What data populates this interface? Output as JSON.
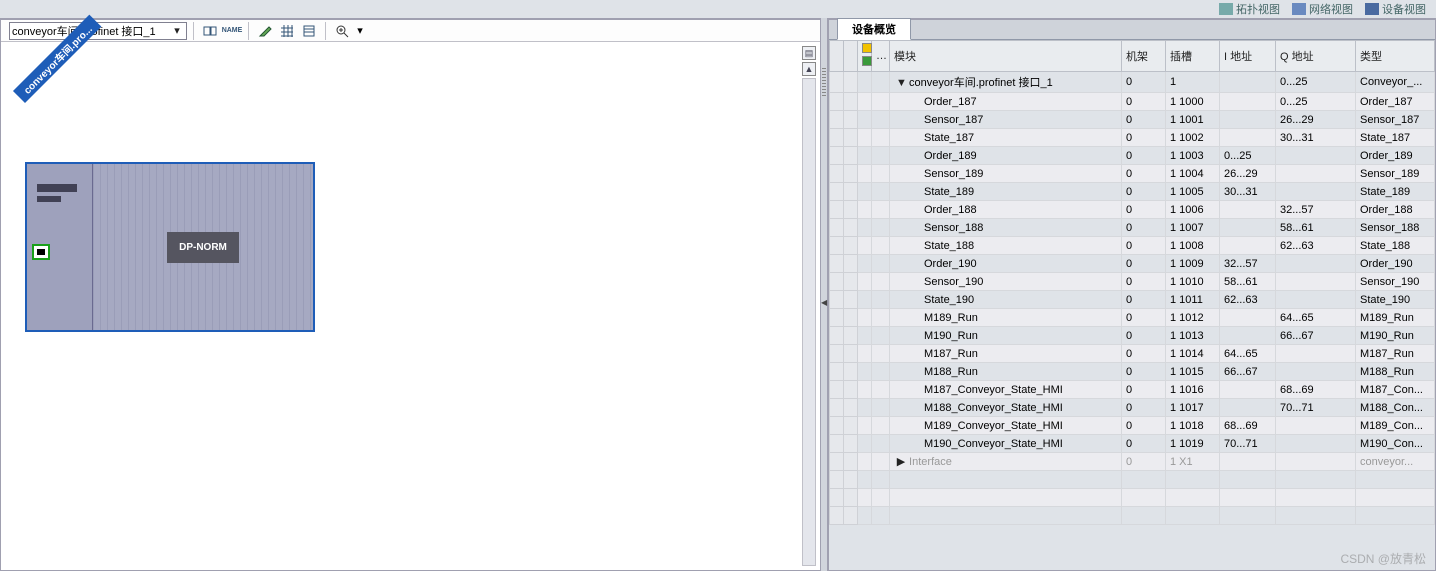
{
  "topTabs": {
    "t1": "拓扑视图",
    "t2": "网络视图",
    "t3": "设备视图"
  },
  "toolbar": {
    "selector": "conveyor车间.profinet 接口_1"
  },
  "editor": {
    "badge": "conveyor车间.pro...",
    "dpnorm": "DP-NORM"
  },
  "panel": {
    "title": "设备概览"
  },
  "columns": {
    "module": "模块",
    "rack": "机架",
    "slot": "插槽",
    "iaddr": "I 地址",
    "qaddr": "Q 地址",
    "type": "类型"
  },
  "rows": [
    {
      "indent": 1,
      "exp": "▼",
      "module": "conveyor车间.profinet 接口_1",
      "rack": "0",
      "slot": "1",
      "iaddr": "",
      "qaddr": "0...25",
      "type": "Conveyor_..."
    },
    {
      "indent": 2,
      "module": "Order_187",
      "rack": "0",
      "slot": "1 1000",
      "iaddr": "",
      "qaddr": "0...25",
      "type": "Order_187"
    },
    {
      "indent": 2,
      "module": "Sensor_187",
      "rack": "0",
      "slot": "1 1001",
      "iaddr": "",
      "qaddr": "26...29",
      "type": "Sensor_187"
    },
    {
      "indent": 2,
      "module": "State_187",
      "rack": "0",
      "slot": "1 1002",
      "iaddr": "",
      "qaddr": "30...31",
      "type": "State_187"
    },
    {
      "indent": 2,
      "module": "Order_189",
      "rack": "0",
      "slot": "1 1003",
      "iaddr": "0...25",
      "qaddr": "",
      "type": "Order_189"
    },
    {
      "indent": 2,
      "module": "Sensor_189",
      "rack": "0",
      "slot": "1 1004",
      "iaddr": "26...29",
      "qaddr": "",
      "type": "Sensor_189"
    },
    {
      "indent": 2,
      "module": "State_189",
      "rack": "0",
      "slot": "1 1005",
      "iaddr": "30...31",
      "qaddr": "",
      "type": "State_189"
    },
    {
      "indent": 2,
      "module": "Order_188",
      "rack": "0",
      "slot": "1 1006",
      "iaddr": "",
      "qaddr": "32...57",
      "type": "Order_188"
    },
    {
      "indent": 2,
      "module": "Sensor_188",
      "rack": "0",
      "slot": "1 1007",
      "iaddr": "",
      "qaddr": "58...61",
      "type": "Sensor_188"
    },
    {
      "indent": 2,
      "module": "State_188",
      "rack": "0",
      "slot": "1 1008",
      "iaddr": "",
      "qaddr": "62...63",
      "type": "State_188"
    },
    {
      "indent": 2,
      "module": "Order_190",
      "rack": "0",
      "slot": "1 1009",
      "iaddr": "32...57",
      "qaddr": "",
      "type": "Order_190"
    },
    {
      "indent": 2,
      "module": "Sensor_190",
      "rack": "0",
      "slot": "1 1010",
      "iaddr": "58...61",
      "qaddr": "",
      "type": "Sensor_190"
    },
    {
      "indent": 2,
      "module": "State_190",
      "rack": "0",
      "slot": "1 1011",
      "iaddr": "62...63",
      "qaddr": "",
      "type": "State_190"
    },
    {
      "indent": 2,
      "module": "M189_Run",
      "rack": "0",
      "slot": "1 1012",
      "iaddr": "",
      "qaddr": "64...65",
      "type": "M189_Run"
    },
    {
      "indent": 2,
      "module": "M190_Run",
      "rack": "0",
      "slot": "1 1013",
      "iaddr": "",
      "qaddr": "66...67",
      "type": "M190_Run"
    },
    {
      "indent": 2,
      "module": "M187_Run",
      "rack": "0",
      "slot": "1 1014",
      "iaddr": "64...65",
      "qaddr": "",
      "type": "M187_Run"
    },
    {
      "indent": 2,
      "module": "M188_Run",
      "rack": "0",
      "slot": "1 1015",
      "iaddr": "66...67",
      "qaddr": "",
      "type": "M188_Run"
    },
    {
      "indent": 2,
      "module": "M187_Conveyor_State_HMI",
      "rack": "0",
      "slot": "1 1016",
      "iaddr": "",
      "qaddr": "68...69",
      "type": "M187_Con..."
    },
    {
      "indent": 2,
      "module": "M188_Conveyor_State_HMI",
      "rack": "0",
      "slot": "1 1017",
      "iaddr": "",
      "qaddr": "70...71",
      "type": "M188_Con..."
    },
    {
      "indent": 2,
      "module": "M189_Conveyor_State_HMI",
      "rack": "0",
      "slot": "1 1018",
      "iaddr": "68...69",
      "qaddr": "",
      "type": "M189_Con..."
    },
    {
      "indent": 2,
      "module": "M190_Conveyor_State_HMI",
      "rack": "0",
      "slot": "1 1019",
      "iaddr": "70...71",
      "qaddr": "",
      "type": "M190_Con..."
    },
    {
      "indent": 1,
      "exp": "▶",
      "module": "Interface",
      "rack": "0",
      "slot": "1 X1",
      "iaddr": "",
      "qaddr": "",
      "type": "conveyor...",
      "dim": true
    }
  ],
  "watermark": "CSDN @放青松"
}
